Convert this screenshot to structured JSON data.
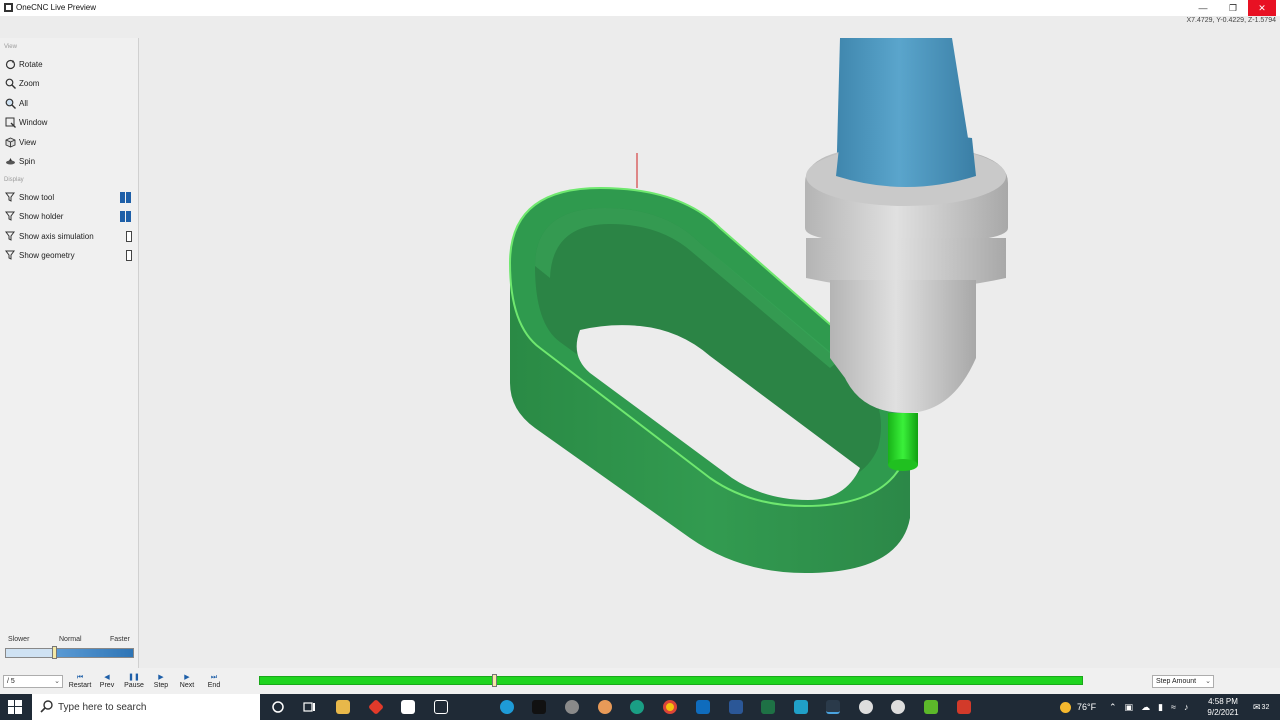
{
  "window": {
    "title": "OneCNC Live Preview",
    "coordinates": "X7.4729, Y-0.4229, Z-1.5794",
    "close_icon": "close-icon",
    "minimize_icon": "minimize-icon",
    "restore_icon": "restore-icon"
  },
  "sidebar": {
    "view_section": "View",
    "view_items": [
      {
        "label": "Rotate",
        "icon": "rotate-icon"
      },
      {
        "label": "Zoom",
        "icon": "zoom-icon"
      },
      {
        "label": "All",
        "icon": "zoom-all-icon"
      },
      {
        "label": "Window",
        "icon": "window-icon"
      },
      {
        "label": "View",
        "icon": "view-cube-icon"
      },
      {
        "label": "Spin",
        "icon": "spin-icon"
      }
    ],
    "display_section": "Display",
    "display_items": [
      {
        "label": "Show tool",
        "checked": true
      },
      {
        "label": "Show holder",
        "checked": true
      },
      {
        "label": "Show axis simulation",
        "checked": false
      },
      {
        "label": "Show geometry",
        "checked": false
      }
    ],
    "speed": {
      "slower": "Slower",
      "normal": "Normal",
      "faster": "Faster",
      "level": 0.38
    }
  },
  "controls": {
    "step_combo": "/ 5",
    "buttons": [
      "Restart",
      "Prev",
      "Pause",
      "Step",
      "Next",
      "End"
    ],
    "progress": 0.285,
    "step_amount": "Step Amount"
  },
  "taskbar": {
    "search_placeholder": "Type here to search",
    "temperature": "76°F",
    "time": "4:58 PM",
    "date": "9/2/2021",
    "notifications": "32"
  },
  "colors": {
    "part_green": "#2e8b4a",
    "tool_green": "#22cc22",
    "holder_blue": "#4a93b8",
    "holder_grey": "#c8c8c8",
    "progress_green": "#1fd41f",
    "close_red": "#e81123",
    "accent_blue": "#1e5fa8"
  }
}
